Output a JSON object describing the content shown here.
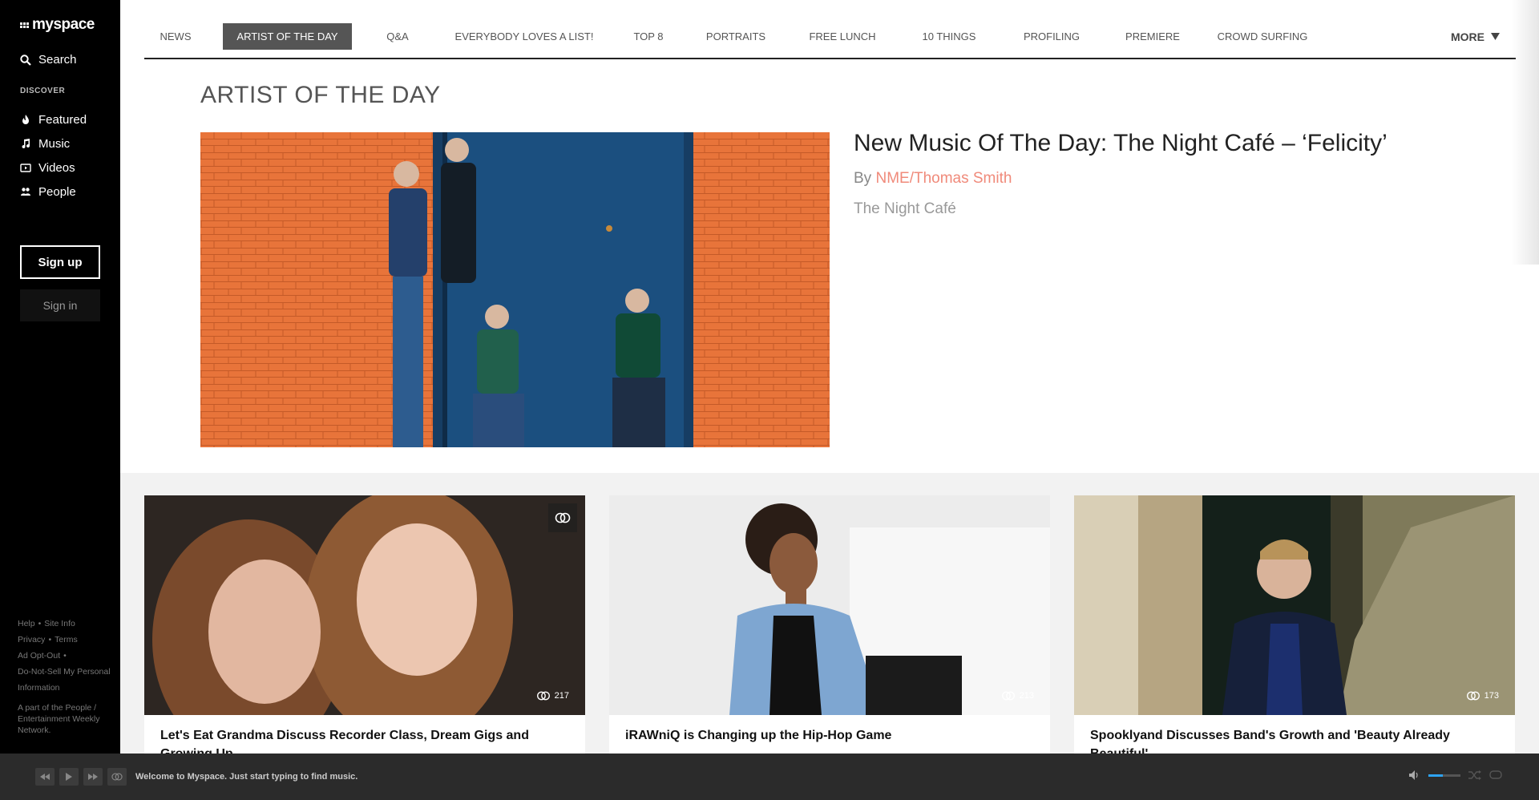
{
  "brand": {
    "name": "myspace"
  },
  "sidebar": {
    "search_label": "Search",
    "discover_heading": "DISCOVER",
    "items": [
      {
        "label": "Featured",
        "icon": "flame-icon"
      },
      {
        "label": "Music",
        "icon": "music-note-icon"
      },
      {
        "label": "Videos",
        "icon": "video-icon"
      },
      {
        "label": "People",
        "icon": "people-icon"
      }
    ],
    "signup_label": "Sign up",
    "signin_label": "Sign in",
    "footer": {
      "help": "Help",
      "site_info": "Site Info",
      "privacy": "Privacy",
      "terms": "Terms",
      "ad_opt_out": "Ad Opt-Out",
      "do_not_sell": "Do-Not-Sell My Personal Information",
      "network": "A part of the People / Entertainment Weekly Network."
    }
  },
  "top_nav": {
    "tabs": [
      "NEWS",
      "ARTIST OF THE DAY",
      "Q&A",
      "EVERYBODY LOVES A LIST!",
      "TOP 8",
      "PORTRAITS",
      "FREE LUNCH",
      "10 THINGS",
      "PROFILING",
      "PREMIERE",
      "CROWD SURFING"
    ],
    "active_tab": "ARTIST OF THE DAY",
    "more_label": "MORE"
  },
  "section_title": "ARTIST OF THE DAY",
  "hero": {
    "title": "New Music Of The Day: The Night Café – ‘Felicity’",
    "by_prefix": "By",
    "author": "NME/Thomas Smith",
    "artist": "The Night Café"
  },
  "cards": [
    {
      "title": "Let's Eat Grandma Discuss Recorder Class, Dream Gigs and Growing Up",
      "views": "217"
    },
    {
      "title": "iRAWniQ is Changing up the Hip-Hop Game",
      "views": "213"
    },
    {
      "title": "Spooklyand Discusses Band's Growth and 'Beauty Already Beautiful'",
      "views": "173"
    }
  ],
  "player": {
    "message": "Welcome to Myspace. Just start typing to find music.",
    "volume_level": 0.45
  },
  "colors": {
    "sidebar_bg": "#000000",
    "active_tab_bg": "#555555",
    "author_link": "#f08a7a",
    "player_bg": "#2b2b2b",
    "volume_accent": "#2ea3f2"
  }
}
